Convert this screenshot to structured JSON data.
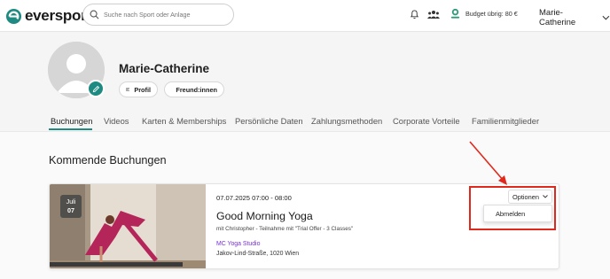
{
  "header": {
    "brand": "eversports",
    "search_placeholder": "Suche nach Sport oder Anlage",
    "budget_text": "Budget übrig: 80 €",
    "user_name": "Marie-Catherine",
    "icons": [
      "bell-icon",
      "people-icon",
      "budget-logo-icon",
      "chevron-down-icon"
    ]
  },
  "profile": {
    "name": "Marie-Catherine",
    "profil_label": "Profil",
    "friends_label": "Freund:innen"
  },
  "tabs": [
    {
      "label": "Buchungen",
      "active": true
    },
    {
      "label": "Videos",
      "active": false
    },
    {
      "label": "Karten & Memberships",
      "active": false
    },
    {
      "label": "Persönliche Daten",
      "active": false
    },
    {
      "label": "Zahlungsmethoden",
      "active": false
    },
    {
      "label": "Corporate Vorteile",
      "active": false
    },
    {
      "label": "Familienmitglieder",
      "active": false
    }
  ],
  "section_title": "Kommende Buchungen",
  "booking": {
    "month": "Juli",
    "day": "07",
    "datetime": "07.07.2025 07:00 - 08:00",
    "title": "Good Morning Yoga",
    "subtitle": "mit Christopher - Teilnahme mit \"Trial Offer - 3 Classes\"",
    "studio": "MC Yoga Studio",
    "address": "Jakov-Lind-Straße, 1020 Wien",
    "options_label": "Optionen",
    "dropdown_item": "Abmelden"
  },
  "colors": {
    "brand": "#1f8a82",
    "link": "#7a2fd6",
    "highlight": "#e0281c"
  }
}
